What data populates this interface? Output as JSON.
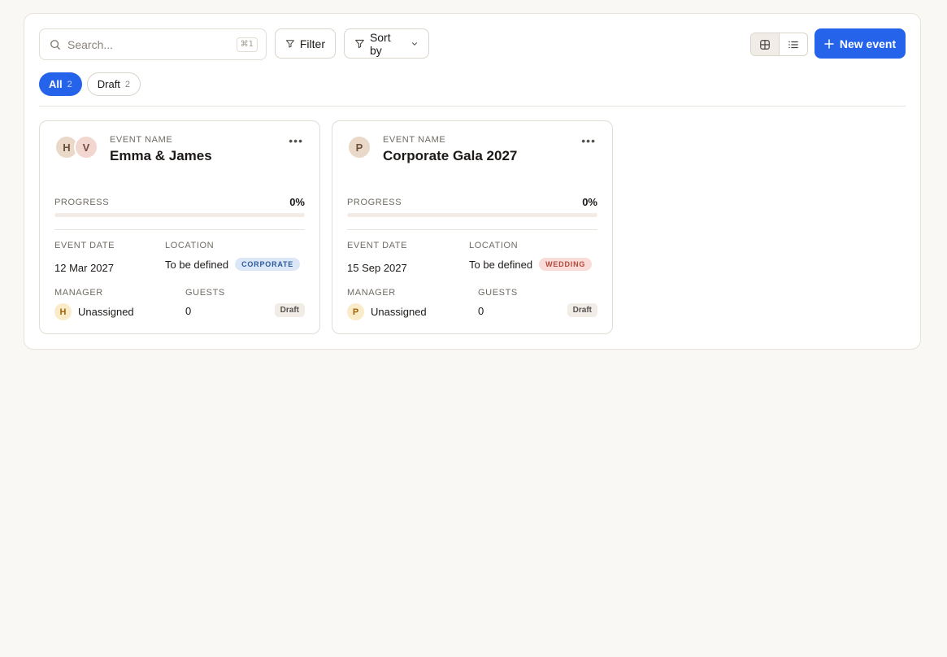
{
  "toolbar": {
    "search_placeholder": "Search...",
    "search_shortcut": "⌘1",
    "filter_label": "Filter",
    "sort_label": "Sort by",
    "new_event_label": "New event"
  },
  "tabs": [
    {
      "label": "All",
      "count": "2",
      "active": true
    },
    {
      "label": "Draft",
      "count": "2",
      "active": false
    }
  ],
  "colors": {
    "accent": "#2563eb"
  },
  "events": [
    {
      "avatars": [
        "H",
        "V"
      ],
      "name_label": "EVENT NAME",
      "name": "Emma & James",
      "progress_label": "PROGRESS",
      "progress_text": "0%",
      "progress": 0,
      "date_label": "EVENT DATE",
      "date": "12 Mar 2027",
      "location_label": "LOCATION",
      "location": "To be defined",
      "type": "CORPORATE",
      "manager_label": "MANAGER",
      "manager_initial": "H",
      "manager": "Unassigned",
      "guests_label": "GUESTS",
      "guests": "0",
      "status": "Draft"
    },
    {
      "avatars": [
        "P"
      ],
      "name_label": "EVENT NAME",
      "name": "Corporate Gala 2027",
      "progress_label": "PROGRESS",
      "progress_text": "0%",
      "progress": 0,
      "date_label": "EVENT DATE",
      "date": "15 Sep 2027",
      "location_label": "LOCATION",
      "location": "To be defined",
      "type": "WEDDING",
      "manager_label": "MANAGER",
      "manager_initial": "P",
      "manager": "Unassigned",
      "guests_label": "GUESTS",
      "guests": "0",
      "status": "Draft"
    }
  ]
}
